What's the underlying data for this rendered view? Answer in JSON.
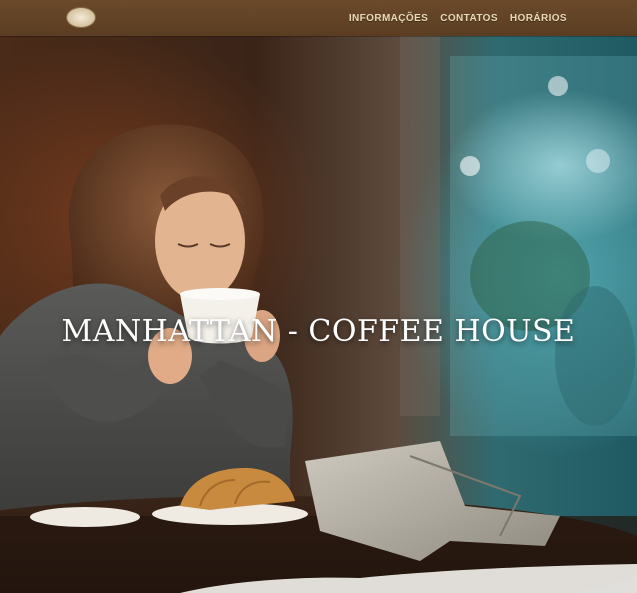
{
  "header": {
    "logo_icon": "coffee-house-crest-icon",
    "logo_monogram": "",
    "nav": [
      {
        "label": "INFORMAÇÕES"
      },
      {
        "label": "CONTATOS"
      },
      {
        "label": "HORÁRIOS"
      }
    ],
    "colors": {
      "header_bg": "#5f4226",
      "nav_text": "#e9d9b8"
    }
  },
  "hero": {
    "title": "MANHATTAN - COFFEE HOUSE",
    "image_icon": "cafe-woman-drinking-coffee-photo",
    "colors": {
      "title": "#ffffff"
    }
  }
}
